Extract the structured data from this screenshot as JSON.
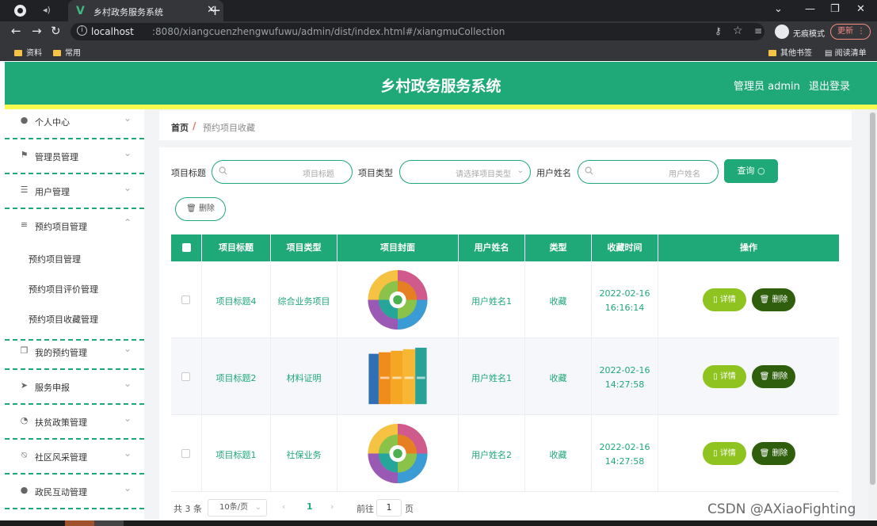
{
  "browser": {
    "tab_title": "乡村政务服务系统",
    "tab_logo": "V",
    "url_host": "localhost",
    "url_path": ":8080/xiangcuenzhengwufuwu/admin/dist/index.html#/xiangmuCollection",
    "incognito_label": "无痕模式",
    "update_label": "更新",
    "bookmarks": [
      "资料",
      "常用"
    ],
    "bookmarks_right": [
      "其他书签",
      "阅读清单"
    ]
  },
  "header": {
    "title": "乡村政务服务系统",
    "admin": "管理员 admin",
    "logout": "退出登录",
    "accent": "#1fa878",
    "stripe": "#f7f94e"
  },
  "sidebar": {
    "items": [
      {
        "label": "个人中心",
        "icon": "user-icon"
      },
      {
        "label": "管理员管理",
        "icon": "flag-icon"
      },
      {
        "label": "用户管理",
        "icon": "sliders-icon"
      },
      {
        "label": "预约项目管理",
        "icon": "list-icon"
      },
      {
        "label": "我的预约管理",
        "icon": "copy-icon"
      },
      {
        "label": "服务申报",
        "icon": "send-icon"
      },
      {
        "label": "扶贫政策管理",
        "icon": "gauge-icon"
      },
      {
        "label": "社区风采管理",
        "icon": "bell-off-icon"
      },
      {
        "label": "政民互动管理",
        "icon": "user-icon"
      }
    ],
    "submenu": [
      "预约项目管理",
      "预约项目评价管理",
      "预约项目收藏管理"
    ]
  },
  "breadcrumb": {
    "home": "首页",
    "separator": "/",
    "current": "预约项目收藏"
  },
  "filters": {
    "title_label": "项目标题",
    "title_placeholder": "项目标题",
    "type_label": "项目类型",
    "type_placeholder": "请选择项目类型",
    "user_label": "用户姓名",
    "user_placeholder": "用户姓名",
    "query_button": "查询"
  },
  "delete_button": "删除",
  "table": {
    "headers": [
      "项目标题",
      "项目类型",
      "项目封面",
      "用户姓名",
      "类型",
      "收藏时间",
      "操作"
    ],
    "rows": [
      {
        "title": "项目标题4",
        "type": "综合业务项目",
        "cover": "wheel-chart",
        "user": "用户姓名1",
        "kind": "收藏",
        "date": "2022-02-16",
        "time": "16:16:14"
      },
      {
        "title": "项目标题2",
        "type": "材料证明",
        "cover": "binders",
        "user": "用户姓名1",
        "kind": "收藏",
        "date": "2022-02-16",
        "time": "14:27:58"
      },
      {
        "title": "项目标题1",
        "type": "社保业务",
        "cover": "wheel-chart",
        "user": "用户姓名2",
        "kind": "收藏",
        "date": "2022-02-16",
        "time": "14:27:58"
      }
    ],
    "detail_label": "详情",
    "delete_label": "删除"
  },
  "pagination": {
    "total": "共 3 条",
    "page_size": "10条/页",
    "current_page": "1",
    "goto_label": "前往",
    "goto_value": "1",
    "page_suffix": "页"
  },
  "watermark": "CSDN @AXiaoFighting"
}
